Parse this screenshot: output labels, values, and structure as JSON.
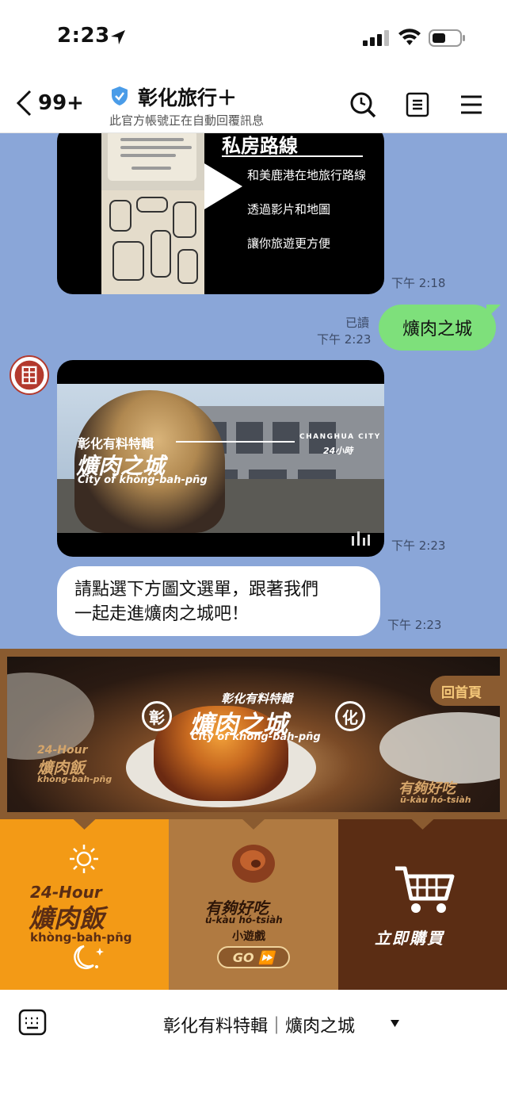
{
  "status_bar": {
    "time": "2:23",
    "icons": [
      "location-arrow-icon",
      "signal-icon",
      "wifi-icon",
      "battery-icon"
    ]
  },
  "header": {
    "unread_count": "99+",
    "account_name": "彰化旅行＋",
    "subtitle": "此官方帳號正在自動回覆訊息",
    "icons": [
      "back-icon",
      "verified-shield-icon",
      "search-icon",
      "notes-icon",
      "menu-icon"
    ]
  },
  "messages": {
    "video1": {
      "title": "私房路線",
      "lines": [
        "和美鹿港在地旅行路線",
        "透過影片和地圖",
        "讓你旅遊更方便"
      ],
      "timestamp": "下午 2:18"
    },
    "user_message": {
      "text": "爌肉之城",
      "read_label": "已讀",
      "timestamp": "下午 2:23"
    },
    "video2": {
      "tag": "彰化有料特輯",
      "title": "爌肉之城",
      "subtitle": "City of khòng-bah-pn̄g",
      "city_label": "CHANGHUA CITY",
      "hour_label": "24小時",
      "timestamp": "下午 2:23"
    },
    "text_message": {
      "line1": "請點選下方圖文選單，跟著我們",
      "line2": "一起走進爌肉之城吧！",
      "timestamp": "下午 2:23"
    }
  },
  "rich_menu": {
    "banner": {
      "home_label": "回首頁",
      "tag": "彰化有料特輯",
      "title": "爌肉之城",
      "subtitle": "City of khòng-bah-pn̄g",
      "circle_left": "彰",
      "circle_right": "化",
      "left_line1": "24-Hour",
      "left_line2": "爌肉飯",
      "left_line3": "khòng-bah-pn̄g",
      "right_line1": "有夠好吃",
      "right_line2": "ū-kàu hó-tsiàh"
    },
    "tile_24hour": {
      "line1": "24-Hour",
      "line2": "爌肉飯",
      "line3": "khòng-bah-pn̄g"
    },
    "tile_game": {
      "line1": "有夠好吃",
      "line2": "ū-kàu hó-tsiàh",
      "line3": "小遊戲",
      "go_label": "GO ⏩"
    },
    "tile_buy": {
      "label": "立即購買"
    },
    "colors": {
      "frame": "#8a5b30",
      "tile_orange": "#f39a16",
      "tile_tan": "#b07a41",
      "tile_dark": "#5b2d14"
    }
  },
  "bottom_bar": {
    "menu_title": "彰化有料特輯｜爌肉之城",
    "icons": [
      "keyboard-icon",
      "caret-down-icon"
    ]
  },
  "colors": {
    "chat_background": "#8aa6d8",
    "user_bubble": "#7ee07b",
    "verified_shield": "#4a9ce8"
  }
}
